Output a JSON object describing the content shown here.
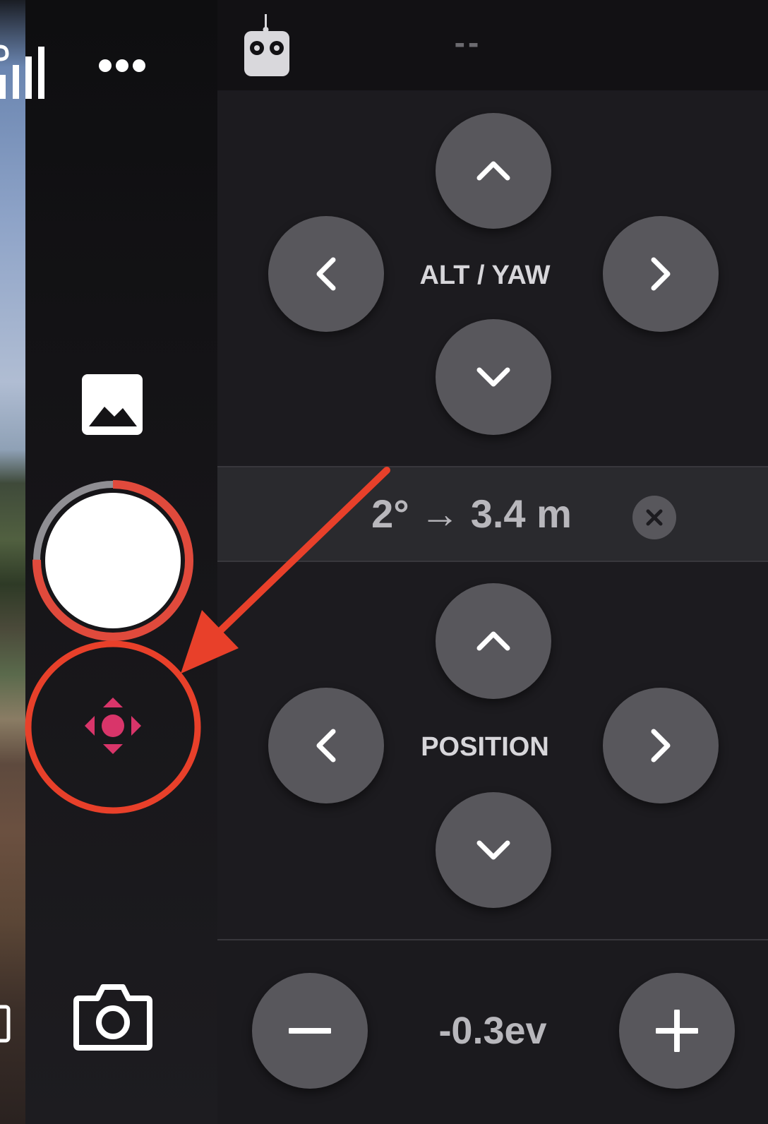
{
  "status_bar": {
    "connection_status": "--",
    "signal_icon": "signal-bars-icon",
    "remote_icon": "remote-controller-icon",
    "more_icon": "more-horizontal-icon"
  },
  "sidebar": {
    "gallery_icon": "gallery-image-icon",
    "shutter": {
      "icon": "shutter-button",
      "progress_ratio": 0.25
    },
    "control_mode_icon": "move-arrows-icon",
    "camera_icon": "camera-icon"
  },
  "alt_yaw_pad": {
    "label": "ALT / YAW",
    "buttons": [
      "up",
      "left",
      "right",
      "down"
    ]
  },
  "info": {
    "distance": "2° → 3.4 m",
    "clear_icon": "close-icon"
  },
  "position_pad": {
    "label": "POSITION",
    "buttons": [
      "up",
      "left",
      "right",
      "down"
    ]
  },
  "exposure": {
    "value": "-0.3ev",
    "minus_icon": "minus-icon",
    "plus_icon": "plus-icon"
  },
  "annotation": {
    "color": "#e8402a",
    "highlighted_control": "control-mode"
  },
  "colors": {
    "accent_pink": "#d9356a",
    "button_gray": "#58575c",
    "shutter_ring": "#e04a3c"
  }
}
